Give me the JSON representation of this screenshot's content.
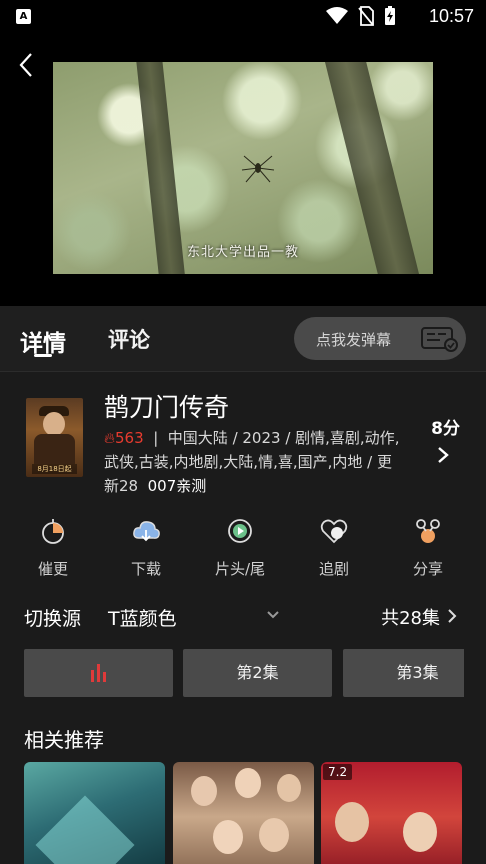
{
  "status_bar": {
    "app_icon_letter": "A",
    "time": "10:57",
    "icons": [
      "wifi-icon",
      "no-sim-icon",
      "battery-charging-icon"
    ]
  },
  "player": {
    "subtitle": "东北大学出品一教"
  },
  "tabs": {
    "details": "详情",
    "comments": "评论"
  },
  "danmaku": {
    "label": "点我发弹幕"
  },
  "show": {
    "title": "鹊刀门传奇",
    "heat": "563",
    "meta": "中国大陆 / 2023 / 剧情,喜剧,动作,武侠,古装,内地剧,大陆,情,喜,国产,内地 / 更新28",
    "tag": "007亲测",
    "score": "8分",
    "poster_caption": "8月18日起"
  },
  "actions": [
    {
      "label": "催更",
      "icon": "urge-icon"
    },
    {
      "label": "下载",
      "icon": "download-icon"
    },
    {
      "label": "片头/尾",
      "icon": "skip-intro-icon"
    },
    {
      "label": "追剧",
      "icon": "follow-icon"
    },
    {
      "label": "分享",
      "icon": "share-icon"
    }
  ],
  "source": {
    "label": "切换源",
    "value": "T蓝颜色",
    "episodes_total": "共28集"
  },
  "episodes": {
    "ep2": "第2集",
    "ep3": "第3集",
    "playing_color": "#e03a3a"
  },
  "related": {
    "title": "相关推荐",
    "items": [
      {
        "badge": ""
      },
      {
        "badge": ""
      },
      {
        "badge": "7.2"
      }
    ]
  }
}
